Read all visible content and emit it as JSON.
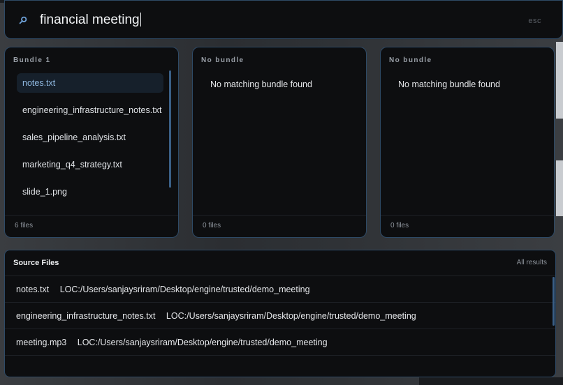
{
  "search": {
    "query": "financial meeting",
    "esc_label": "esc"
  },
  "bundles": [
    {
      "title": "Bundle 1",
      "files": [
        "notes.txt",
        "engineering_infrastructure_notes.txt",
        "sales_pipeline_analysis.txt",
        "marketing_q4_strategy.txt",
        "slide_1.png"
      ],
      "selected_index": 0,
      "empty_message": "",
      "count_label": "6 files"
    },
    {
      "title": "No bundle",
      "files": [],
      "empty_message": "No matching bundle found",
      "count_label": "0 files"
    },
    {
      "title": "No bundle",
      "files": [],
      "empty_message": "No matching bundle found",
      "count_label": "0 files"
    }
  ],
  "source_files": {
    "title": "Source Files",
    "all_results_label": "All results",
    "rows": [
      {
        "name": "notes.txt",
        "location": "LOC:/Users/sanjaysriram/Desktop/engine/trusted/demo_meeting"
      },
      {
        "name": "engineering_infrastructure_notes.txt",
        "location": "LOC:/Users/sanjaysriram/Desktop/engine/trusted/demo_meeting"
      },
      {
        "name": "meeting.mp3",
        "location": "LOC:/Users/sanjaysriram/Desktop/engine/trusted/demo_meeting"
      }
    ]
  },
  "colors": {
    "panel_bg": "#0d0e10",
    "border": "#2e4a66",
    "selected_bg": "#16202b",
    "selected_text": "#8fb8e0",
    "accent": "#3a5f86"
  },
  "icons": {
    "search": "search-icon"
  }
}
